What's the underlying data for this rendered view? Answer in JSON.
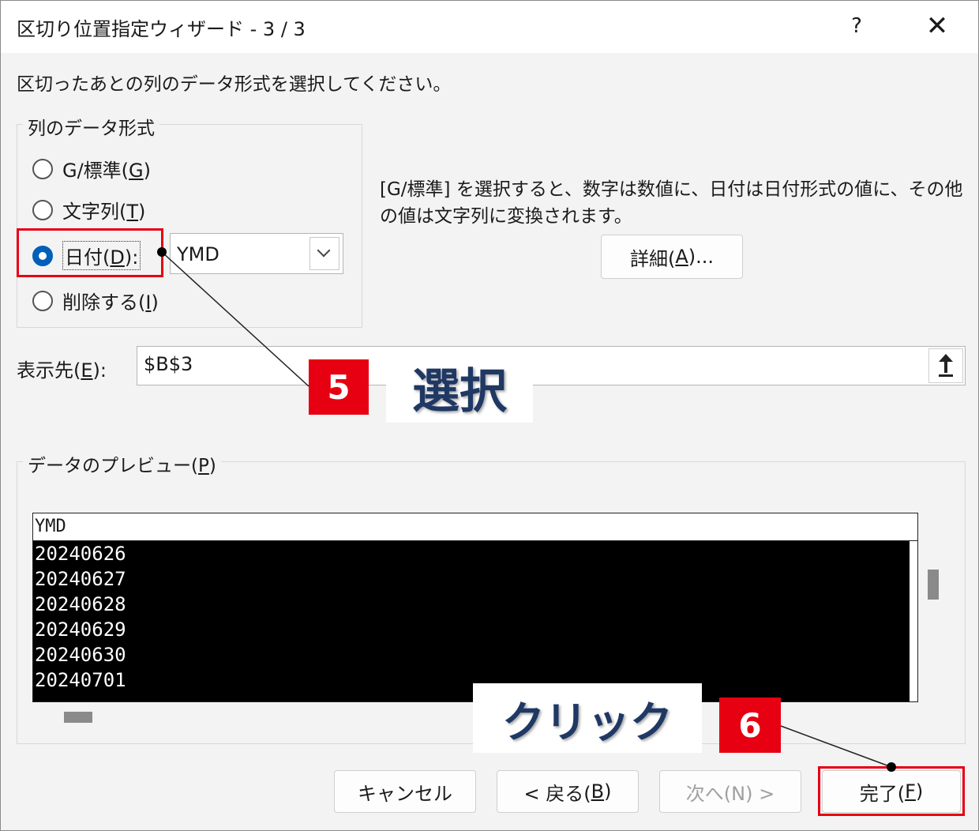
{
  "dialog": {
    "title": "区切り位置指定ウィザード - 3 / 3",
    "help": "?",
    "close": "✕",
    "instruction": "区切ったあとの列のデータ形式を選択してください。"
  },
  "column_format": {
    "legend": "列のデータ形式",
    "options": [
      {
        "text": "G/標準(",
        "key": "G",
        "end": ")",
        "checked": false
      },
      {
        "text": "文字列(",
        "key": "T",
        "end": ")",
        "checked": false
      },
      {
        "text": "日付(",
        "key": "D",
        "end": "):",
        "checked": true
      },
      {
        "text": "削除する(",
        "key": "I",
        "end": ")",
        "checked": false
      }
    ],
    "date_format_value": "YMD"
  },
  "description": "[G/標準] を選択すると、数字は数値に、日付は日付形式の値に、その他の値は文字列に変換されます。",
  "details_button": {
    "text": "詳細(",
    "key": "A",
    "end": ")..."
  },
  "destination": {
    "label": "表示先(",
    "key": "E",
    "end": "):",
    "value": "$B$3"
  },
  "preview": {
    "legend": "データのプレビュー(",
    "key": "P",
    "end": ")",
    "header": "YMD",
    "rows": [
      "20240626",
      "20240627",
      "20240628",
      "20240629",
      "20240630",
      "20240701"
    ]
  },
  "buttons": {
    "cancel": "キャンセル",
    "back": "< 戻る(",
    "back_key": "B",
    "back_end": ")",
    "next": "次へ(N) >",
    "finish": "完了(",
    "finish_key": "F",
    "finish_end": ")"
  },
  "annotations": {
    "step5_number": "5",
    "step5_text": "選択",
    "step6_number": "6",
    "step6_text": "クリック",
    "highlight_color": "#e60012",
    "callout_text_color": "#1f3864"
  }
}
